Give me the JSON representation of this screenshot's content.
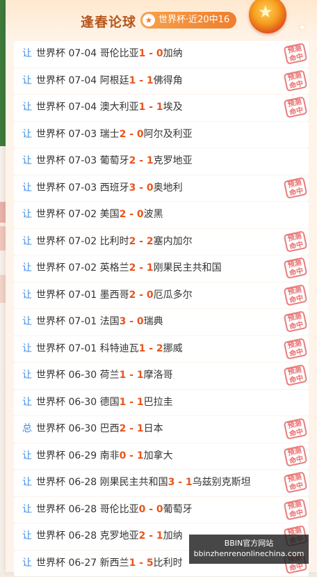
{
  "header": {
    "title": "逢春论球",
    "badge": "世界杯·近20中16"
  },
  "stamp_text": [
    "预测",
    "命中"
  ],
  "rows": [
    {
      "tag": "让",
      "league": "世界杯",
      "date": "07-04",
      "home": "哥伦比亚",
      "hs": "1",
      "as": "0",
      "away": "加纳",
      "hit": true
    },
    {
      "tag": "让",
      "league": "世界杯",
      "date": "07-04",
      "home": "阿根廷",
      "hs": "1",
      "as": "1",
      "away": "佛得角",
      "hit": true
    },
    {
      "tag": "让",
      "league": "世界杯",
      "date": "07-04",
      "home": "澳大利亚",
      "hs": "1",
      "as": "1",
      "away": "埃及",
      "hit": true
    },
    {
      "tag": "让",
      "league": "世界杯",
      "date": "07-03",
      "home": "瑞士",
      "hs": "2",
      "as": "0",
      "away": "阿尔及利亚",
      "hit": false
    },
    {
      "tag": "让",
      "league": "世界杯",
      "date": "07-03",
      "home": "葡萄牙",
      "hs": "2",
      "as": "1",
      "away": "克罗地亚",
      "hit": false
    },
    {
      "tag": "让",
      "league": "世界杯",
      "date": "07-03",
      "home": "西班牙",
      "hs": "3",
      "as": "0",
      "away": "奥地利",
      "hit": true
    },
    {
      "tag": "让",
      "league": "世界杯",
      "date": "07-02",
      "home": "美国",
      "hs": "2",
      "as": "0",
      "away": "波黑",
      "hit": false
    },
    {
      "tag": "让",
      "league": "世界杯",
      "date": "07-02",
      "home": "比利时",
      "hs": "2",
      "as": "2",
      "away": "塞内加尔",
      "hit": true
    },
    {
      "tag": "让",
      "league": "世界杯",
      "date": "07-02",
      "home": "英格兰",
      "hs": "2",
      "as": "1",
      "away": "刚果民主共和国",
      "hit": true
    },
    {
      "tag": "让",
      "league": "世界杯",
      "date": "07-01",
      "home": "墨西哥",
      "hs": "2",
      "as": "0",
      "away": "厄瓜多尔",
      "hit": true
    },
    {
      "tag": "让",
      "league": "世界杯",
      "date": "07-01",
      "home": "法国",
      "hs": "3",
      "as": "0",
      "away": "瑞典",
      "hit": true
    },
    {
      "tag": "让",
      "league": "世界杯",
      "date": "07-01",
      "home": "科特迪瓦",
      "hs": "1",
      "as": "2",
      "away": "挪威",
      "hit": true
    },
    {
      "tag": "让",
      "league": "世界杯",
      "date": "06-30",
      "home": "荷兰",
      "hs": "1",
      "as": "1",
      "away": "摩洛哥",
      "hit": true
    },
    {
      "tag": "让",
      "league": "世界杯",
      "date": "06-30",
      "home": "德国",
      "hs": "1",
      "as": "1",
      "away": "巴拉圭",
      "hit": false
    },
    {
      "tag": "总",
      "league": "世界杯",
      "date": "06-30",
      "home": "巴西",
      "hs": "2",
      "as": "1",
      "away": "日本",
      "hit": true
    },
    {
      "tag": "让",
      "league": "世界杯",
      "date": "06-29",
      "home": "南非",
      "hs": "0",
      "as": "1",
      "away": "加拿大",
      "hit": true
    },
    {
      "tag": "让",
      "league": "世界杯",
      "date": "06-28",
      "home": "刚果民主共和国",
      "hs": "3",
      "as": "1",
      "away": "乌兹别克斯坦",
      "hit": true
    },
    {
      "tag": "让",
      "league": "世界杯",
      "date": "06-28",
      "home": "哥伦比亚",
      "hs": "0",
      "as": "0",
      "away": "葡萄牙",
      "hit": true
    },
    {
      "tag": "让",
      "league": "世界杯",
      "date": "06-28",
      "home": "克罗地亚",
      "hs": "2",
      "as": "1",
      "away": "加纳",
      "hit": true
    },
    {
      "tag": "让",
      "league": "世界杯",
      "date": "06-27",
      "home": "新西兰",
      "hs": "1",
      "as": "5",
      "away": "比利时",
      "hit": true
    }
  ],
  "overlay": {
    "line1": "BBIN官方网站",
    "line2": "bbinzhenrenonlinechina.com"
  }
}
